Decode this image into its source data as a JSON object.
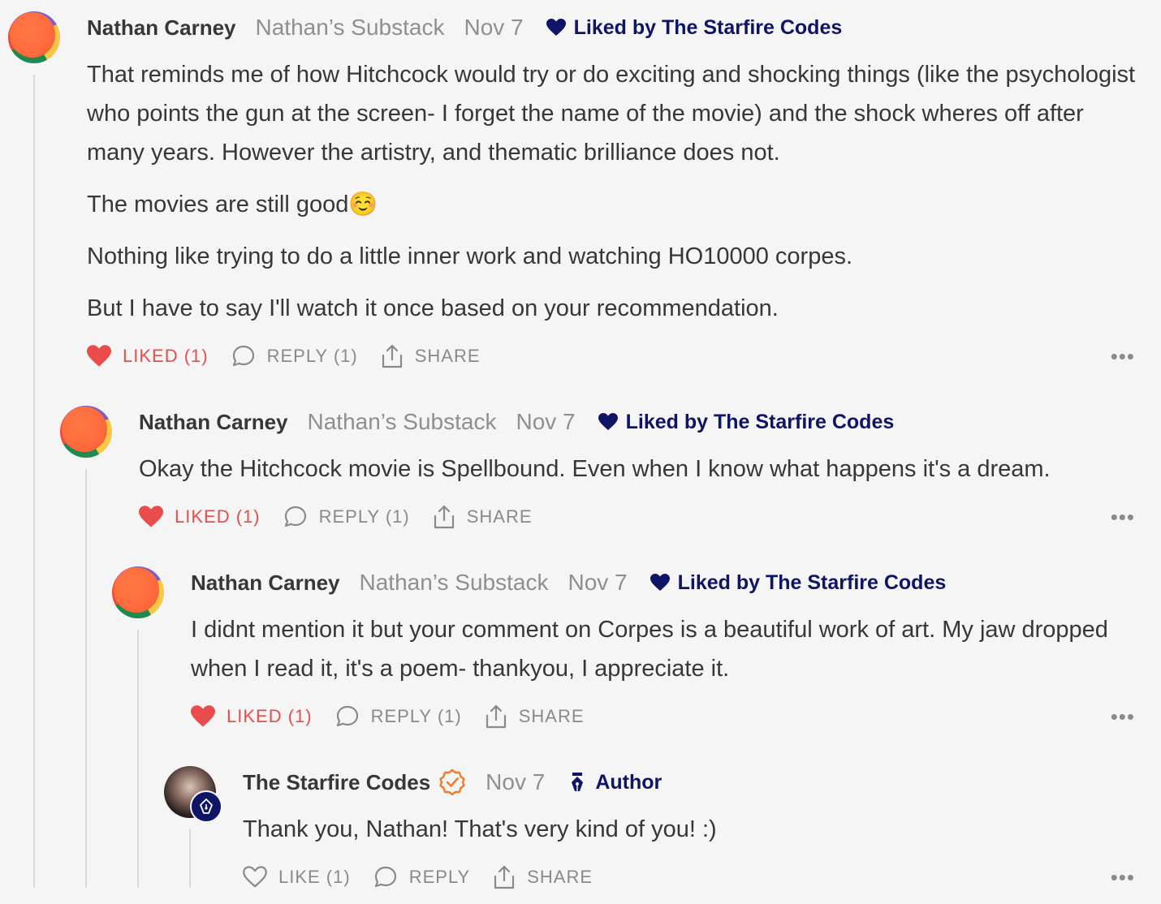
{
  "colors": {
    "liked": "#e84c4c",
    "navy": "#0f1566",
    "muted": "#8f8f8f",
    "verified": "#f07c2b"
  },
  "comments": [
    {
      "author": "Nathan Carney",
      "publication": "Nathan’s Substack",
      "date": "Nov 7",
      "badge": "Liked by The Starfire Codes",
      "paragraphs": [
        "That reminds me of how Hitchcock would try or do exciting and shocking things (like the psychologist who points the gun at the screen- I forget the name of the movie) and the shock wheres off after many years. However the artistry, and thematic brilliance does not.",
        "The movies are still good☺️",
        "Nothing like trying to do a little inner work and watching HO10000 corpes.",
        "But I have to say I'll watch it once based on your recommendation."
      ],
      "like_label": "LIKED (1)",
      "reply_label": "REPLY (1)",
      "share_label": "SHARE",
      "more": "•••"
    },
    {
      "author": "Nathan Carney",
      "publication": "Nathan’s Substack",
      "date": "Nov 7",
      "badge": "Liked by The Starfire Codes",
      "paragraphs": [
        "Okay the Hitchcock movie is Spellbound. Even when I know what happens it's a dream."
      ],
      "like_label": "LIKED (1)",
      "reply_label": "REPLY (1)",
      "share_label": "SHARE",
      "more": "•••"
    },
    {
      "author": "Nathan Carney",
      "publication": "Nathan’s Substack",
      "date": "Nov 7",
      "badge": "Liked by The Starfire Codes",
      "paragraphs": [
        "I didnt mention it but your comment on Corpes is a beautiful work of art. My jaw dropped when I read it, it's a poem- thankyou, I appreciate it."
      ],
      "like_label": "LIKED (1)",
      "reply_label": "REPLY (1)",
      "share_label": "SHARE",
      "more": "•••"
    },
    {
      "author": "The Starfire Codes",
      "date": "Nov 7",
      "badge": "Author",
      "paragraphs": [
        "Thank you, Nathan! That's very kind of you! :)"
      ],
      "like_label": "LIKE (1)",
      "reply_label": "REPLY",
      "share_label": "SHARE",
      "more": "•••"
    }
  ]
}
